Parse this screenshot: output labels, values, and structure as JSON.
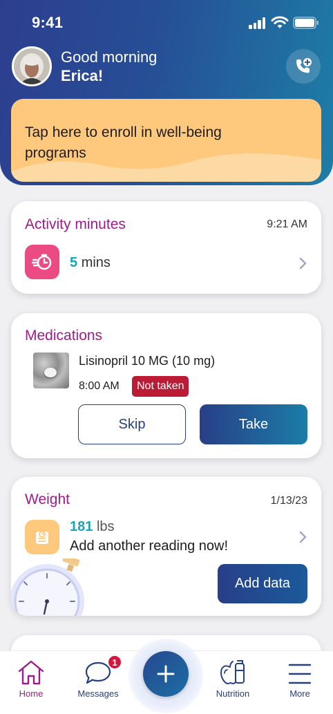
{
  "status_bar": {
    "time": "9:41"
  },
  "header": {
    "greeting_line1": "Good morning",
    "greeting_name": "Erica!",
    "call_icon": "phone-plus-icon"
  },
  "enroll_banner": {
    "text": "Tap here to enroll in well-being programs"
  },
  "activity": {
    "title": "Activity minutes",
    "time": "9:21 AM",
    "icon": "stopwatch-fast-icon",
    "value": "5",
    "unit": "mins"
  },
  "medications": {
    "title": "Medications",
    "name": "Lisinopril 10 MG (10 mg)",
    "time": "8:00 AM",
    "status": "Not taken",
    "skip_label": "Skip",
    "take_label": "Take"
  },
  "weight": {
    "title": "Weight",
    "date": "1/13/23",
    "icon": "scale-icon",
    "value": "181",
    "unit": "lbs",
    "prompt": "Add another reading now!",
    "add_label": "Add data"
  },
  "tabbar": {
    "items": [
      {
        "label": "Home",
        "icon": "home-icon",
        "active": true
      },
      {
        "label": "Messages",
        "icon": "chat-bubble-icon",
        "badge": "1"
      },
      {
        "label": "",
        "icon": "plus-icon"
      },
      {
        "label": "Nutrition",
        "icon": "apple-bottle-icon"
      },
      {
        "label": "More",
        "icon": "menu-icon"
      }
    ]
  },
  "colors": {
    "header_gradient_start": "#2d3e8e",
    "header_gradient_end": "#1d7ea7",
    "banner": "#fec97c",
    "title_magenta": "#9d1b8a",
    "value_teal": "#16a5b9",
    "activity_icon_bg": "#ec4a82",
    "badge_red": "#bb1b35",
    "navy": "#25407f"
  }
}
